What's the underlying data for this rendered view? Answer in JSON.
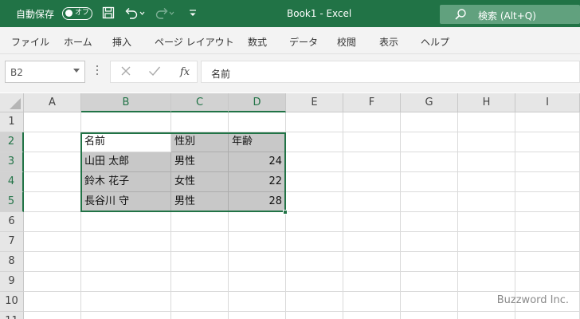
{
  "titlebar": {
    "autosave_label": "自動保存",
    "toggle_label": "オフ",
    "document_title": "Book1  -  Excel",
    "search_text": "検索 (Alt+Q)"
  },
  "ribbon": {
    "tabs": [
      "ファイル",
      "ホーム",
      "挿入",
      "ページ レイアウト",
      "数式",
      "データ",
      "校閲",
      "表示",
      "ヘルプ"
    ]
  },
  "formula_bar": {
    "name_box": "B2",
    "fx_label": "fx",
    "content": "名前"
  },
  "grid": {
    "columns": [
      "A",
      "B",
      "C",
      "D",
      "E",
      "F",
      "G",
      "H",
      "I"
    ],
    "rows": [
      "1",
      "2",
      "3",
      "4",
      "5",
      "6",
      "7",
      "8",
      "9",
      "10",
      "11"
    ],
    "selected_range": "B2:D5",
    "table": [
      [
        "名前",
        "性別",
        "年齢"
      ],
      [
        "山田 太郎",
        "男性",
        "24"
      ],
      [
        "鈴木 花子",
        "女性",
        "22"
      ],
      [
        "長谷川 守",
        "男性",
        "28"
      ]
    ]
  },
  "watermark": "Buzzword Inc.",
  "colors": {
    "accent": "#217346",
    "selection_fill": "#c8c8c8"
  }
}
